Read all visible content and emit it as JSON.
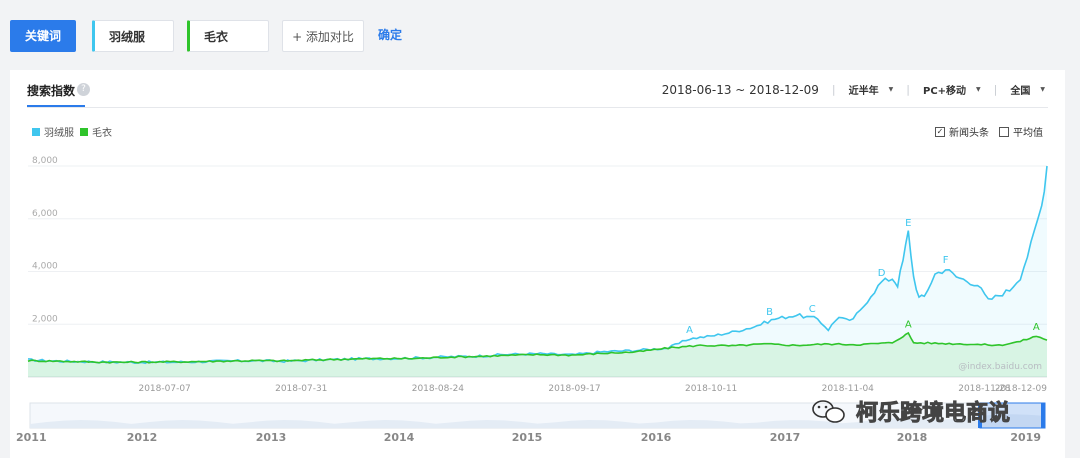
{
  "keywords": {
    "tab_label": "关键词",
    "terms": [
      "羽绒服",
      "毛衣"
    ],
    "add_label": "+ 添加对比",
    "confirm_label": "确定"
  },
  "panel": {
    "title": "搜索指数",
    "date_range": "2018-06-13 ~ 2018-12-09",
    "period": "近半年",
    "device": "PC+移动",
    "region": "全国",
    "news_label": "新闻头条",
    "avg_label": "平均值"
  },
  "watermark": "@index.baidu.com",
  "overlay_text": "柯乐跨境电商说",
  "colors": {
    "series1": "#3fc6ee",
    "series2": "#2fc42b",
    "accent": "#2b7bea"
  },
  "chart_data": {
    "type": "line",
    "title": "",
    "ylim": [
      0,
      8000
    ],
    "y_ticks": [
      "2,000",
      "4,000",
      "6,000",
      "8,000"
    ],
    "x_tick_labels": [
      "2018-07-07",
      "2018-07-31",
      "2018-08-24",
      "2018-09-17",
      "2018-10-11",
      "2018-11-04",
      "2018-11-28",
      "2018-12-09"
    ],
    "x_tick_days": [
      24,
      48,
      72,
      96,
      120,
      144,
      168,
      179
    ],
    "total_days": 180,
    "series": [
      {
        "name": "羽绒服",
        "color": "#3fc6ee",
        "points": [
          [
            0,
            650
          ],
          [
            6,
            600
          ],
          [
            12,
            580
          ],
          [
            18,
            560
          ],
          [
            24,
            560
          ],
          [
            30,
            570
          ],
          [
            36,
            600
          ],
          [
            42,
            620
          ],
          [
            48,
            600
          ],
          [
            54,
            640
          ],
          [
            60,
            680
          ],
          [
            66,
            700
          ],
          [
            72,
            720
          ],
          [
            78,
            760
          ],
          [
            84,
            790
          ],
          [
            90,
            860
          ],
          [
            96,
            880
          ],
          [
            102,
            840
          ],
          [
            108,
            960
          ],
          [
            114,
            1010
          ],
          [
            120,
            1100
          ],
          [
            124,
            1450
          ],
          [
            128,
            1550
          ],
          [
            132,
            1700
          ],
          [
            136,
            1900
          ],
          [
            140,
            2200
          ],
          [
            144,
            2350
          ],
          [
            148,
            2200
          ],
          [
            150,
            1800
          ],
          [
            152,
            2300
          ],
          [
            154,
            2100
          ],
          [
            156,
            2500
          ],
          [
            158,
            3100
          ],
          [
            160,
            3600
          ],
          [
            162,
            3750
          ],
          [
            163,
            3500
          ],
          [
            164,
            4400
          ],
          [
            165,
            5500
          ],
          [
            166,
            3800
          ],
          [
            167,
            3000
          ],
          [
            168,
            3050
          ],
          [
            170,
            3900
          ],
          [
            172,
            4100
          ],
          [
            174,
            3800
          ],
          [
            176,
            3650
          ],
          [
            178,
            3500
          ],
          [
            180,
            2900
          ],
          [
            182,
            3100
          ],
          [
            184,
            3300
          ],
          [
            186,
            3800
          ],
          [
            188,
            5000
          ],
          [
            190,
            6500
          ],
          [
            191,
            8000
          ]
        ],
        "annotations": [
          [
            "A",
            124
          ],
          [
            "B",
            139
          ],
          [
            "C",
            147
          ],
          [
            "D",
            160
          ],
          [
            "E",
            165
          ],
          [
            "F",
            172
          ]
        ]
      },
      {
        "name": "毛衣",
        "color": "#2fc42b",
        "points": [
          [
            0,
            620
          ],
          [
            6,
            600
          ],
          [
            12,
            570
          ],
          [
            18,
            560
          ],
          [
            24,
            570
          ],
          [
            30,
            580
          ],
          [
            36,
            600
          ],
          [
            42,
            620
          ],
          [
            48,
            610
          ],
          [
            54,
            650
          ],
          [
            60,
            680
          ],
          [
            66,
            700
          ],
          [
            72,
            700
          ],
          [
            78,
            750
          ],
          [
            84,
            780
          ],
          [
            90,
            820
          ],
          [
            96,
            850
          ],
          [
            102,
            830
          ],
          [
            108,
            900
          ],
          [
            114,
            950
          ],
          [
            120,
            1100
          ],
          [
            126,
            1200
          ],
          [
            132,
            1180
          ],
          [
            138,
            1250
          ],
          [
            144,
            1200
          ],
          [
            150,
            1250
          ],
          [
            156,
            1230
          ],
          [
            162,
            1300
          ],
          [
            164,
            1550
          ],
          [
            165,
            1650
          ],
          [
            166,
            1300
          ],
          [
            170,
            1280
          ],
          [
            176,
            1250
          ],
          [
            182,
            1200
          ],
          [
            186,
            1350
          ],
          [
            189,
            1550
          ],
          [
            191,
            1400
          ]
        ],
        "annotations": [
          [
            "A",
            165
          ],
          [
            "A",
            189
          ]
        ]
      }
    ],
    "navigator_years": [
      "2011",
      "2012",
      "2013",
      "2014",
      "2015",
      "2016",
      "2017",
      "2018",
      "2019"
    ]
  }
}
